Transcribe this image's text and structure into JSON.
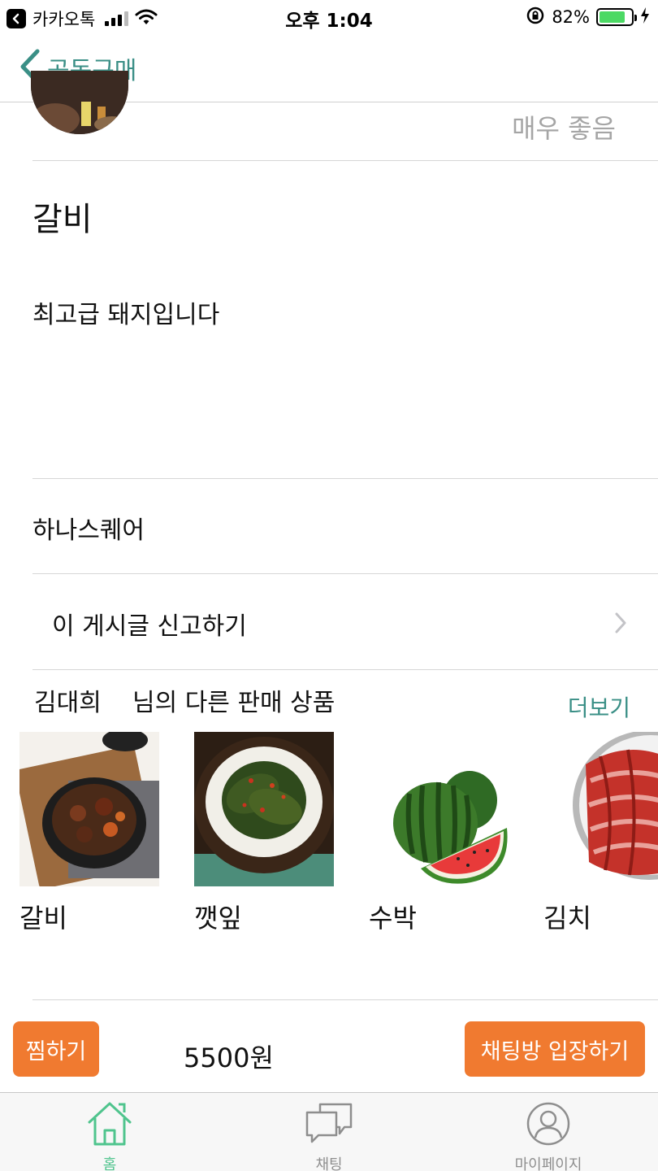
{
  "status_bar": {
    "app": "카카오톡",
    "time": "오후 1:04",
    "battery": "82%",
    "battery_level": 0.82
  },
  "nav": {
    "back_label": "공동구매"
  },
  "post": {
    "rating": "매우 좋음",
    "title": "갈비",
    "description": "최고급 돼지입니다",
    "location": "하나스퀘어",
    "report": "이 게시글 신고하기"
  },
  "other_products": {
    "seller": "김대희",
    "title_suffix": "님의 다른 판매 상품",
    "more": "더보기",
    "items": [
      {
        "name": "갈비",
        "image": "braised-ribs"
      },
      {
        "name": "깻잎",
        "image": "perilla-leaves"
      },
      {
        "name": "수박",
        "image": "watermelon"
      },
      {
        "name": "김치",
        "image": "kimchi"
      }
    ]
  },
  "actions": {
    "wish": "찜하기",
    "price": "5500원",
    "enter_chat": "채팅방 입장하기"
  },
  "tabs": [
    {
      "label": "홈",
      "icon": "home-icon",
      "active": true
    },
    {
      "label": "채팅",
      "icon": "chat-icon",
      "active": false
    },
    {
      "label": "마이페이지",
      "icon": "profile-icon",
      "active": false
    }
  ],
  "colors": {
    "accent": "#3a8f86",
    "button": "#f07a30",
    "active_tab": "#4fc48d",
    "inactive_tab": "#8e8e8e"
  }
}
